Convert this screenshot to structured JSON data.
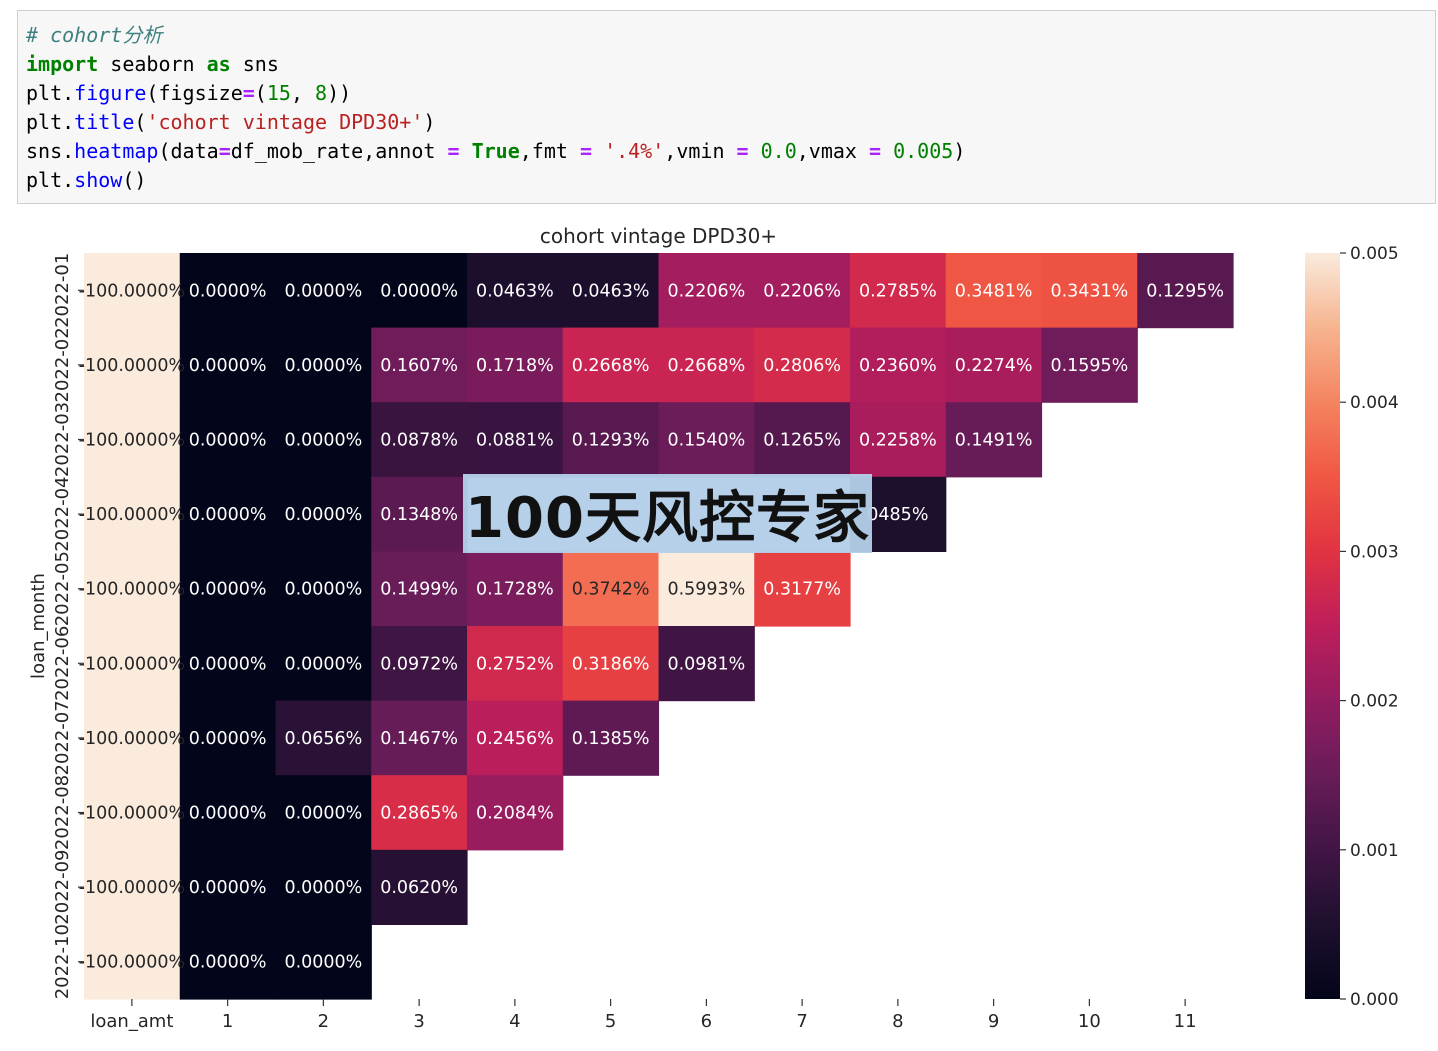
{
  "code": {
    "line1": "# cohort分析",
    "line2": {
      "kw_import": "import",
      "mod": " seaborn ",
      "kw_as": "as",
      "alias": " sns"
    },
    "line3": {
      "pre": "plt.",
      "fn": "figure",
      "a": "(figsize",
      "eq": "=",
      "b": "(",
      "n1": "15",
      "c": ", ",
      "n2": "8",
      "d": "))"
    },
    "line4": {
      "pre": "plt.",
      "fn": "title",
      "a": "(",
      "s": "'cohort vintage DPD30+'",
      "d": ")"
    },
    "line5": {
      "pre": "sns.",
      "fn": "heatmap",
      "a": "(data",
      "eq1": "=",
      "b": "df_mob_rate,annot ",
      "eq2": "=",
      "sp1": " ",
      "t": "True",
      "c": ",fmt ",
      "eq3": "=",
      "sp2": " ",
      "s": "'.4%'",
      "e": ",vmin ",
      "eq4": "=",
      "sp3": " ",
      "n1": "0.0",
      "f": ",vmax ",
      "eq5": "=",
      "sp4": " ",
      "n2": "0.005",
      "g": ")"
    },
    "line6": {
      "pre": "plt.",
      "fn": "show",
      "a": "()"
    }
  },
  "watermark": "100天风控专家",
  "chart_data": {
    "type": "heatmap",
    "title": "cohort vintage DPD30+",
    "ylabel": "loan_month",
    "xlabel": "",
    "x": [
      "loan_amt",
      "1",
      "2",
      "3",
      "4",
      "5",
      "6",
      "7",
      "8",
      "9",
      "10",
      "11"
    ],
    "y": [
      "2022-01",
      "2022-02",
      "2022-03",
      "2022-04",
      "2022-05",
      "2022-06",
      "2022-07",
      "2022-08",
      "2022-09",
      "2022-10"
    ],
    "vmin": 0.0,
    "vmax": 0.005,
    "colormap": "rocket",
    "colorbar_ticks": [
      "0.000",
      "0.001",
      "0.002",
      "0.003",
      "0.004",
      "0.005"
    ],
    "values": [
      [
        -1.0,
        0.0,
        0.0,
        0.0,
        0.000463,
        0.000463,
        0.002206,
        0.002206,
        0.002785,
        0.003481,
        0.003431,
        0.001295
      ],
      [
        -1.0,
        0.0,
        0.0,
        0.001607,
        0.001718,
        0.002668,
        0.002668,
        0.002806,
        0.00236,
        0.002274,
        0.001595,
        null
      ],
      [
        -1.0,
        0.0,
        0.0,
        0.000878,
        0.000881,
        0.001293,
        0.00154,
        0.001265,
        0.002258,
        0.001491,
        null,
        null
      ],
      [
        -1.0,
        0.0,
        0.0,
        0.001348,
        null,
        null,
        null,
        null,
        0.000485,
        null,
        null,
        null
      ],
      [
        -1.0,
        0.0,
        0.0,
        0.001499,
        0.001728,
        0.003742,
        0.005993,
        0.003177,
        null,
        null,
        null,
        null
      ],
      [
        -1.0,
        0.0,
        0.0,
        0.000972,
        0.002752,
        0.003186,
        0.000981,
        null,
        null,
        null,
        null,
        null
      ],
      [
        -1.0,
        0.0,
        0.000656,
        0.001467,
        0.002456,
        0.001385,
        null,
        null,
        null,
        null,
        null,
        null
      ],
      [
        -1.0,
        0.0,
        0.0,
        0.002865,
        0.002084,
        null,
        null,
        null,
        null,
        null,
        null,
        null
      ],
      [
        -1.0,
        0.0,
        0.0,
        0.00062,
        null,
        null,
        null,
        null,
        null,
        null,
        null,
        null
      ],
      [
        -1.0,
        0.0,
        0.0,
        null,
        null,
        null,
        null,
        null,
        null,
        null,
        null,
        null
      ]
    ],
    "annotations": [
      [
        "-100.0000%",
        "0.0000%",
        "0.0000%",
        "0.0000%",
        "0.0463%",
        "0.0463%",
        "0.2206%",
        "0.2206%",
        "0.2785%",
        "0.3481%",
        "0.3431%",
        "0.1295%"
      ],
      [
        "-100.0000%",
        "0.0000%",
        "0.0000%",
        "0.1607%",
        "0.1718%",
        "0.2668%",
        "0.2668%",
        "0.2806%",
        "0.2360%",
        "0.2274%",
        "0.1595%",
        ""
      ],
      [
        "-100.0000%",
        "0.0000%",
        "0.0000%",
        "0.0878%",
        "0.0881%",
        "0.1293%",
        "0.1540%",
        "0.1265%",
        "0.2258%",
        "0.1491%",
        "",
        ""
      ],
      [
        "-100.0000%",
        "0.0000%",
        "0.0000%",
        "0.1348%",
        "",
        "",
        "",
        "",
        "0485%",
        "",
        "",
        ""
      ],
      [
        "-100.0000%",
        "0.0000%",
        "0.0000%",
        "0.1499%",
        "0.1728%",
        "0.3742%",
        "0.5993%",
        "0.3177%",
        "",
        "",
        "",
        ""
      ],
      [
        "-100.0000%",
        "0.0000%",
        "0.0000%",
        "0.0972%",
        "0.2752%",
        "0.3186%",
        "0.0981%",
        "",
        "",
        "",
        "",
        ""
      ],
      [
        "-100.0000%",
        "0.0000%",
        "0.0656%",
        "0.1467%",
        "0.2456%",
        "0.1385%",
        "",
        "",
        "",
        "",
        "",
        ""
      ],
      [
        "-100.0000%",
        "0.0000%",
        "0.0000%",
        "0.2865%",
        "0.2084%",
        "",
        "",
        "",
        "",
        "",
        "",
        ""
      ],
      [
        "-100.0000%",
        "0.0000%",
        "0.0000%",
        "0.0620%",
        "",
        "",
        "",
        "",
        "",
        "",
        "",
        ""
      ],
      [
        "-100.0000%",
        "0.0000%",
        "0.0000%",
        "",
        "",
        "",
        "",
        "",
        "",
        "",
        "",
        ""
      ]
    ],
    "grid": false,
    "legend": "colorbar-right"
  }
}
